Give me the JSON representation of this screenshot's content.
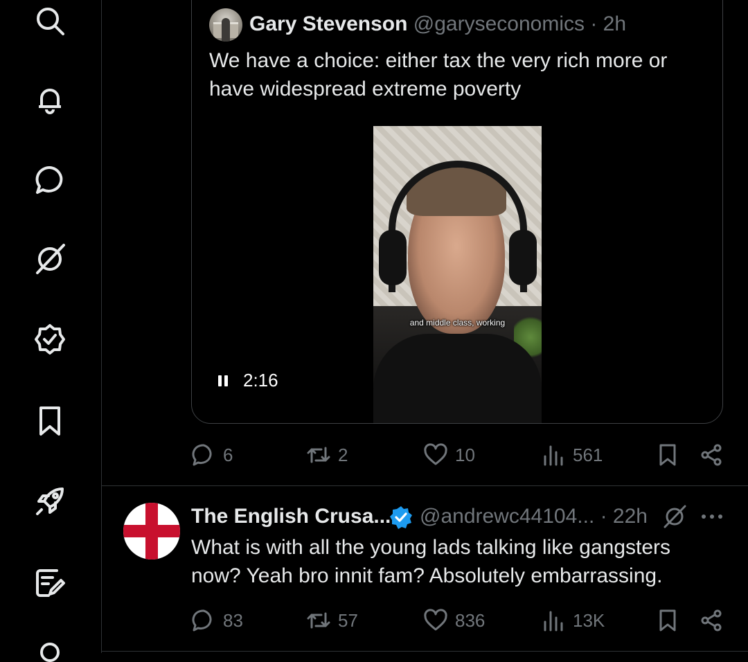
{
  "sidebar": {
    "items": [
      {
        "icon": "search-icon"
      },
      {
        "icon": "bell-icon"
      },
      {
        "icon": "messages-icon"
      },
      {
        "icon": "grok-icon"
      },
      {
        "icon": "verified-icon"
      },
      {
        "icon": "bookmark-icon"
      },
      {
        "icon": "rocket-icon"
      },
      {
        "icon": "compose-icon"
      },
      {
        "icon": "profile-icon"
      }
    ]
  },
  "quoted_tweet": {
    "author_name": "Gary Stevenson",
    "handle": "@garyseconomics",
    "time": "· 2h",
    "text": "We have a choice: either tax the very rich more or have widespread extreme poverty",
    "video": {
      "caption": "and middle class, working",
      "time_remaining": "2:16"
    }
  },
  "tweet1_actions": {
    "replies": "6",
    "reposts": "2",
    "likes": "10",
    "views": "561"
  },
  "tweet2": {
    "author_name": "The English Crusa...",
    "handle": "@andrewc44104... · 22h",
    "text": "What is with all the young lads talking like gangsters now? Yeah bro innit fam? Absolutely embarrassing.",
    "actions": {
      "replies": "83",
      "reposts": "57",
      "likes": "836",
      "views": "13K"
    }
  },
  "colors": {
    "background": "#000000",
    "text": "#e7e9ea",
    "muted": "#71767b",
    "border": "#2f3336",
    "verified": "#1d9bf0"
  }
}
